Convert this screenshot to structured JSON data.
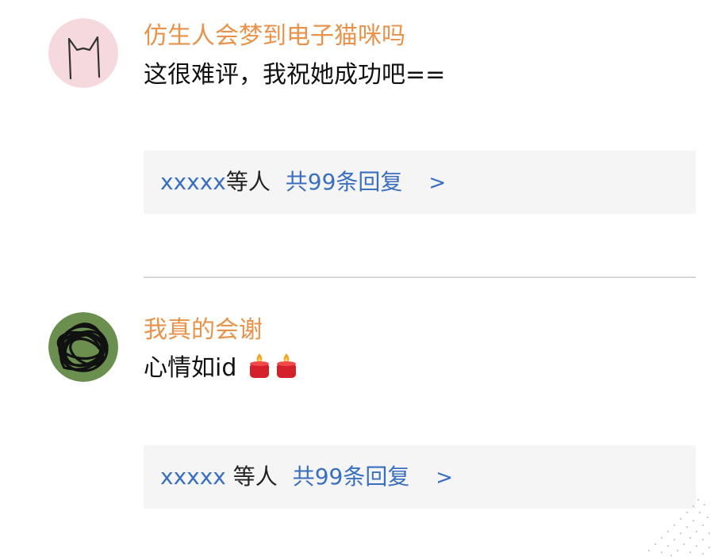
{
  "colors": {
    "username": "#e8924a",
    "link": "#3a6fc0",
    "reply_bg": "#f5f5f5",
    "divider": "#d7d7d7",
    "text": "#111111"
  },
  "comments": [
    {
      "username": "仿生人会梦到电子猫咪吗",
      "content": "这很难评，我祝她成功吧==",
      "avatar_icon": "cat-doodle-avatar",
      "reply": {
        "users": "xxxxx",
        "suffix": "等人",
        "count_label": "共99条回复",
        "chevron": ">"
      }
    },
    {
      "username": "我真的会谢",
      "content": "心情如id",
      "content_icons": [
        "candle-emoji",
        "candle-emoji"
      ],
      "avatar_icon": "scribble-avatar",
      "reply": {
        "users": "xxxxx",
        "suffix": "等人",
        "count_label": "共99条回复",
        "chevron": ">"
      }
    }
  ]
}
